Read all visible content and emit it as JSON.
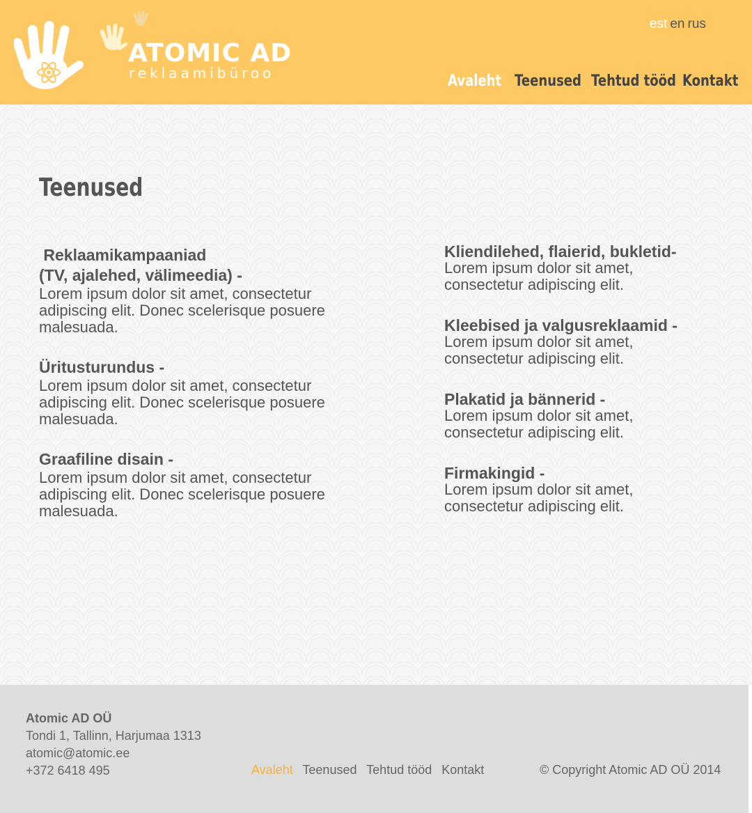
{
  "header": {
    "brand": "ATOMIC AD",
    "brand_sub": "reklaamibüroo",
    "languages": [
      {
        "label": "est",
        "active": true
      },
      {
        "label": "en",
        "active": false
      },
      {
        "label": "rus",
        "active": false
      }
    ],
    "nav": [
      {
        "label": "Avaleht",
        "active": true
      },
      {
        "label": "Teenused",
        "active": false
      },
      {
        "label": "Tehtud tööd",
        "active": false
      },
      {
        "label": "Kontakt",
        "active": false
      }
    ]
  },
  "main": {
    "title": "Teenused",
    "left_services": [
      {
        "title_line1": " Reklaamikampaaniad",
        "title_line2": "(TV, ajalehed, välimeedia) -",
        "text": "Lorem ipsum dolor sit amet, consectetur adipiscing elit. Donec scelerisque posuere malesuada."
      },
      {
        "title_line1": "Üritusturundus -",
        "title_line2": "",
        "text": "Lorem ipsum dolor sit amet, consectetur adipiscing elit. Donec scelerisque posuere malesuada."
      },
      {
        "title_line1": "Graafiline disain -",
        "title_line2": "",
        "text": "Lorem ipsum dolor sit amet, consectetur adipiscing elit. Donec scelerisque posuere malesuada."
      }
    ],
    "right_services": [
      {
        "title": "Kliendilehed, flaierid, bukletid-",
        "text": "Lorem ipsum dolor sit amet, consectetur adipiscing elit."
      },
      {
        "title": "Kleebised ja valgusreklaamid -",
        "text": "Lorem ipsum dolor sit amet, consectetur adipiscing elit."
      },
      {
        "title": "Plakatid ja bännerid -",
        "text": "Lorem ipsum dolor sit amet, consectetur adipiscing elit."
      },
      {
        "title": "Firmakingid -",
        "text": "Lorem ipsum dolor sit amet, consectetur adipiscing elit."
      }
    ]
  },
  "footer": {
    "company": "Atomic AD OÜ",
    "address": "Tondi 1, Tallinn, Harjumaa 1313",
    "email": "atomic@atomic.ee",
    "phone": "+372 6418 495",
    "nav": [
      {
        "label": "Avaleht",
        "active": true
      },
      {
        "label": "Teenused",
        "active": false
      },
      {
        "label": "Tehtud tööd",
        "active": false
      },
      {
        "label": "Kontakt",
        "active": false
      }
    ],
    "copyright": "© Copyright Atomic AD OÜ 2014"
  },
  "colors": {
    "header_bg": "#fec962",
    "accent": "#f7b135",
    "text": "#555555",
    "footer_bg": "#dddddd"
  },
  "icons": [
    "hand-atom-logo-icon",
    "small-hand-icon",
    "tiny-hand-icon"
  ]
}
